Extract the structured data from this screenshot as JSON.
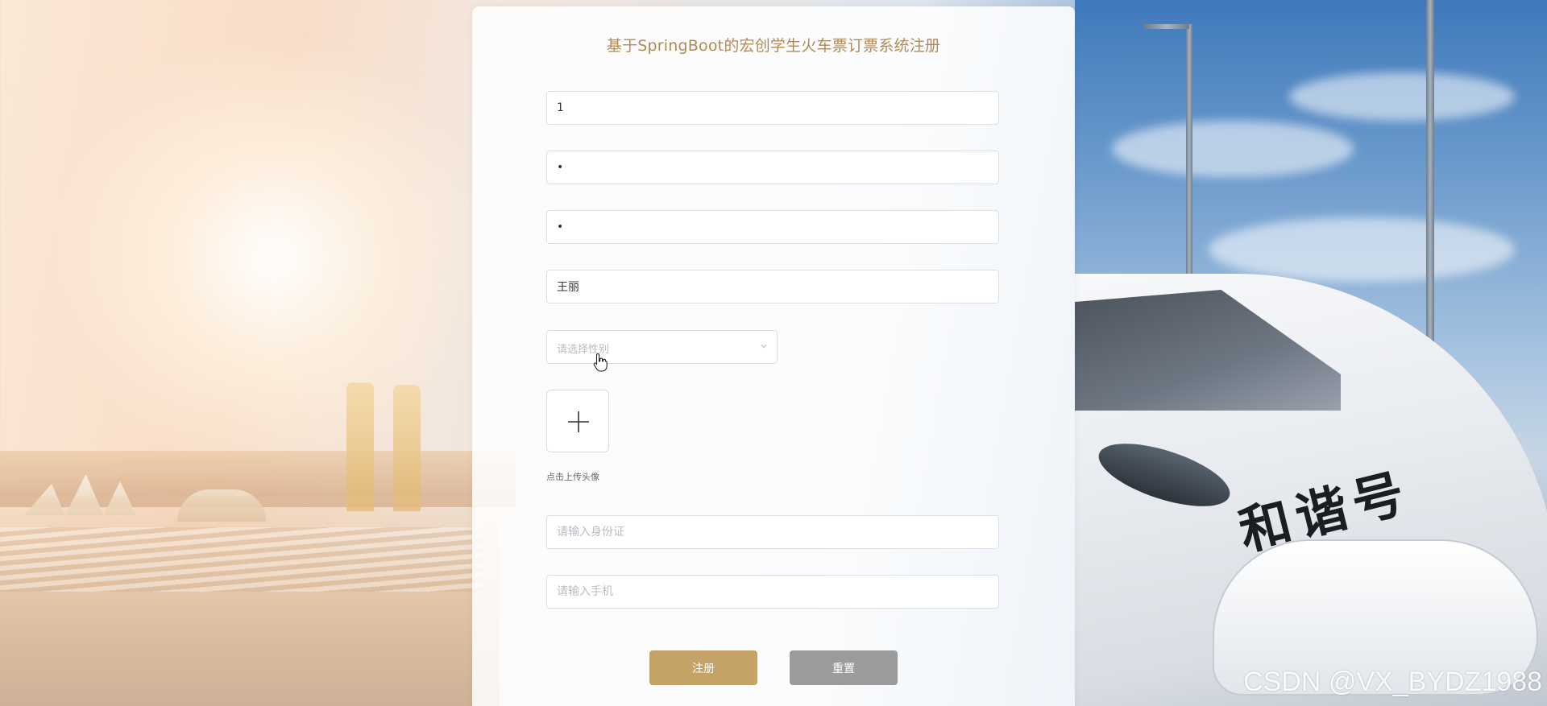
{
  "form": {
    "title": "基于SpringBoot的宏创学生火车票订票系统注册",
    "account_value": "1",
    "password_value": "•",
    "confirm_password_value": "•",
    "name_value": "王丽",
    "gender_placeholder": "请选择性别",
    "avatar_upload_label": "点击上传头像",
    "id_card_placeholder": "请输入身份证",
    "phone_placeholder": "请输入手机",
    "register_button": "注册",
    "reset_button": "重置"
  },
  "background": {
    "train_text": "和谐号"
  },
  "watermark": "CSDN @VX_BYDZ1988",
  "colors": {
    "title": "#b08a56",
    "register_button": "#c5a265",
    "reset_button": "#9b9b9b"
  },
  "icons": [
    "plus-icon",
    "chevron-down-icon",
    "hand-cursor-icon"
  ]
}
